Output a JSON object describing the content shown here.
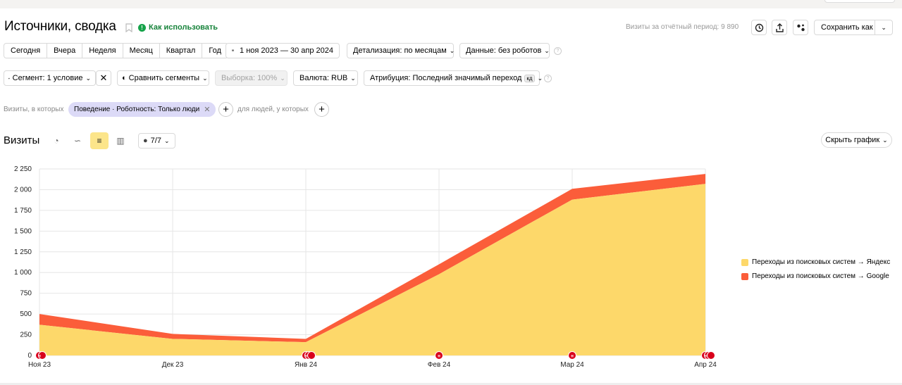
{
  "header": {
    "title": "Источники, сводка",
    "how_to": "Как использовать",
    "visits_period": "Визиты за отчётный период: 9 890",
    "save_as": "Сохранить как"
  },
  "periods": [
    "Сегодня",
    "Вчера",
    "Неделя",
    "Месяц",
    "Квартал",
    "Год"
  ],
  "toolbar": {
    "date_range": "1 ноя 2023 — 30 апр 2024",
    "detail": "Детализация: по месяцам",
    "data": "Данные: без роботов",
    "segment": "Сегмент: 1 условие",
    "compare": "Сравнить сегменты",
    "sample": "Выборка: 100%",
    "currency": "Валюта: RUB",
    "attribution": "Атрибуция: Последний значимый переход",
    "attribution_badge": "кд"
  },
  "filters": {
    "visits_label": "Визиты, в которых",
    "chip": "Поведение · Роботность: Только люди",
    "people_label": "для людей, у которых"
  },
  "chart_header": {
    "title": "Визиты",
    "series_count": "7/7",
    "hide_chart": "Скрыть график"
  },
  "colors": {
    "yandex": "#fdd86a",
    "google": "#fb5d3a",
    "grid": "#e6e6e6",
    "marker": "#d9001b"
  },
  "chart_data": {
    "type": "area",
    "stacked": true,
    "x": [
      "Ноя 23",
      "Дек 23",
      "Янв 24",
      "Фев 24",
      "Мар 24",
      "Апр 24"
    ],
    "ylim": [
      0,
      2250
    ],
    "yticks": [
      0,
      250,
      500,
      750,
      1000,
      1250,
      1500,
      1750,
      2000,
      2250
    ],
    "ytick_labels": [
      "0",
      "250",
      "500",
      "750",
      "1 000",
      "1 250",
      "1 500",
      "1 750",
      "2 000",
      "2 250"
    ],
    "series": [
      {
        "name": "Переходы из поисковых систем → Яндекс",
        "values": [
          370,
          200,
          160,
          980,
          1880,
          2070
        ],
        "color": "#fdd86a"
      },
      {
        "name": "Переходы из поисковых систем → Google",
        "values": [
          130,
          60,
          40,
          120,
          130,
          120
        ],
        "color": "#fb5d3a"
      }
    ],
    "markers": [
      {
        "x": "Ноя 23",
        "count": 2
      },
      {
        "x": "Янв 24",
        "count": 3
      },
      {
        "x": "Фев 24",
        "count": 1
      },
      {
        "x": "Мар 24",
        "count": 1
      },
      {
        "x": "Апр 24",
        "count": 3
      }
    ],
    "marker_label": "н",
    "grid": true,
    "legend": "right"
  }
}
